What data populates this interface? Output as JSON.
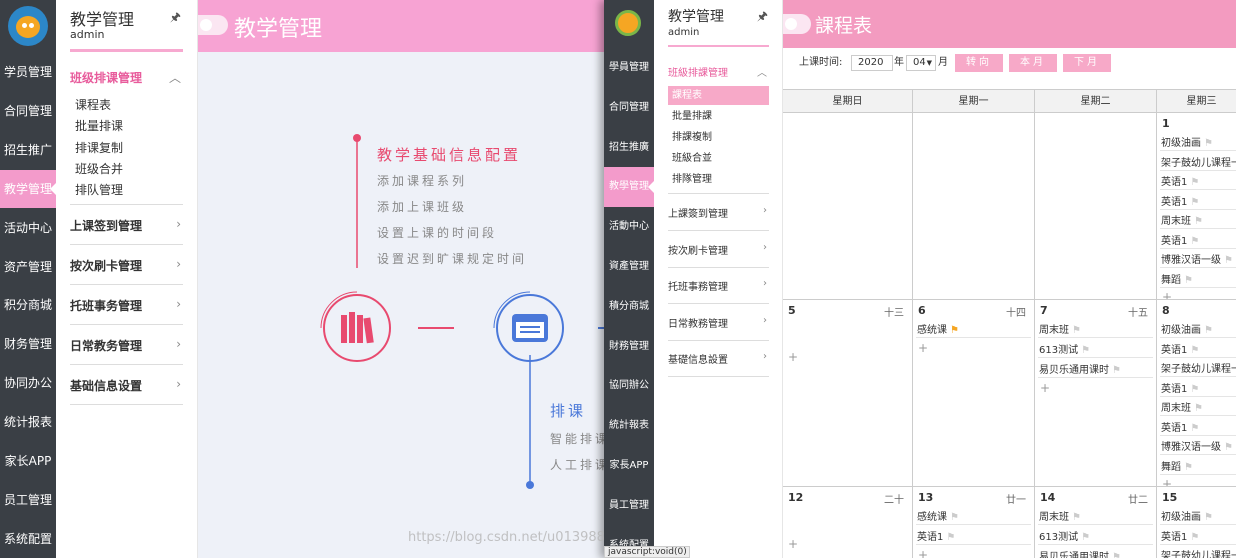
{
  "left": {
    "nav": [
      "学员管理",
      "合同管理",
      "招生推广",
      "教学管理",
      "活动中心",
      "资产管理",
      "积分商城",
      "财务管理",
      "协同办公",
      "统计报表",
      "家长APP",
      "员工管理",
      "系统配置"
    ],
    "active_nav": 3,
    "sub_title": "教学管理",
    "user": "admin",
    "pin": "🖈",
    "open_group": "班级排课管理",
    "open_items": [
      "课程表",
      "批量排课",
      "排课复制",
      "班级合并",
      "排队管理"
    ],
    "groups": [
      "上课签到管理",
      "按次刷卡管理",
      "托班事务管理",
      "日常教务管理",
      "基础信息设置"
    ],
    "header_title": "教学管理",
    "info_title": "教学基础信息配置",
    "info_items": [
      "添加课程系列",
      "添加上课班级",
      "设置上课的时间段",
      "设置迟到旷课规定时间"
    ],
    "pk_title": "排课",
    "pk_items": [
      "智能排课",
      "人工排课"
    ]
  },
  "right": {
    "nav": [
      "學員管理",
      "合同管理",
      "招生推廣",
      "教學管理",
      "活動中心",
      "資產管理",
      "積分商城",
      "財務管理",
      "協同辦公",
      "統計報表",
      "家長APP",
      "員工管理",
      "系統配置"
    ],
    "active_nav": 3,
    "sub_title": "教学管理",
    "user": "admin",
    "pin": "🖈",
    "open_group": "班級排課管理",
    "open_items": [
      "課程表",
      "批量排課",
      "排課複制",
      "班級合並",
      "排隊管理"
    ],
    "groups": [
      "上課簽到管理",
      "按次刷卡管理",
      "托班事務管理",
      "日常教務管理",
      "基礎信息設置"
    ],
    "header_title": "課程表",
    "toolbar": {
      "label": "上课时间:",
      "year": "2020",
      "year_unit": "年",
      "month": "04",
      "month_unit": "月",
      "btn_go": "转向",
      "btn_this": "本月",
      "btn_next": "下月"
    },
    "weekdays": [
      "星期日",
      "星期一",
      "星期二",
      "星期三"
    ],
    "weeks": [
      [
        {
          "day": "",
          "lunar": "",
          "events": []
        },
        {
          "day": "",
          "lunar": "",
          "events": []
        },
        {
          "day": "",
          "lunar": "",
          "events": []
        },
        {
          "day": "1",
          "lunar": "",
          "events": [
            "初级油画",
            "架子鼓幼儿课程一",
            "英语1",
            "英语1",
            "周末班",
            "英语1",
            "博雅汉语一级",
            "舞蹈"
          ]
        }
      ],
      [
        {
          "day": "5",
          "lunar": "十三",
          "events": []
        },
        {
          "day": "6",
          "lunar": "十四",
          "events": [
            "感统课"
          ]
        },
        {
          "day": "7",
          "lunar": "十五",
          "events": [
            "周末班",
            "613测试",
            "易贝乐通用课时"
          ]
        },
        {
          "day": "8",
          "lunar": "",
          "events": [
            "初级油画",
            "英语1",
            "架子鼓幼儿课程一",
            "英语1",
            "周末班",
            "英语1",
            "博雅汉语一级",
            "舞蹈"
          ]
        }
      ],
      [
        {
          "day": "12",
          "lunar": "二十",
          "events": []
        },
        {
          "day": "13",
          "lunar": "廿一",
          "events": [
            "感统课",
            "英语1"
          ]
        },
        {
          "day": "14",
          "lunar": "廿二",
          "events": [
            "周末班",
            "613测试",
            "易贝乐通用课时"
          ]
        },
        {
          "day": "15",
          "lunar": "",
          "events": [
            "初级油画",
            "英语1",
            "架子鼓幼儿课程一"
          ]
        }
      ]
    ]
  },
  "status_bar": "javascript:void(0)",
  "watermark": "https://blog.csdn.net/u013988",
  "colors": {
    "accent_pink": "#f39bcb",
    "nav_bg": "#3a3f45",
    "info_red": "#e84a6f",
    "pk_blue": "#4a78d9"
  }
}
